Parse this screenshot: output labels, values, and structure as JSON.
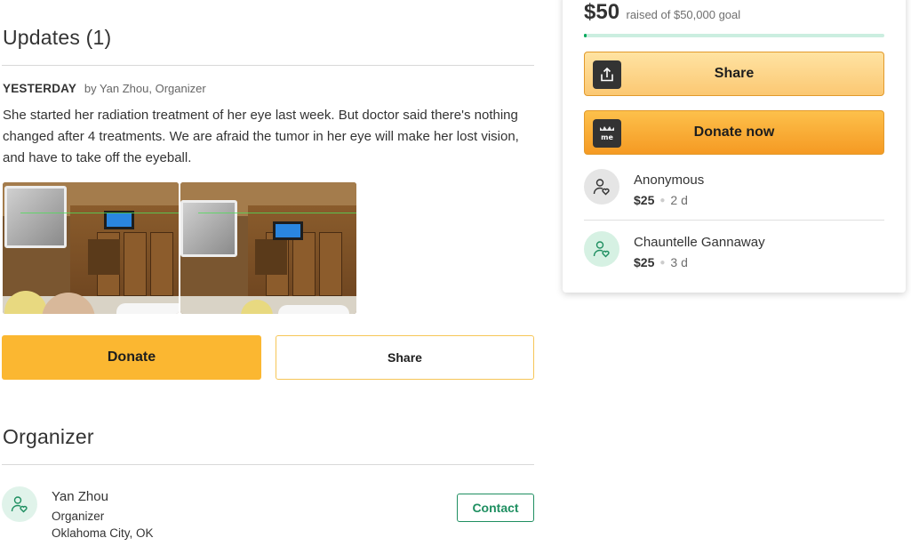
{
  "updates": {
    "title": "Updates (1)",
    "when": "YESTERDAY",
    "byline": "by Yan Zhou, Organizer",
    "text": "She started her radiation treatment of her eye last week. But doctor said there's nothing changed after 4 treatments. We are afraid the tumor in her eye will make her lost vision, and have to take off the eyeball."
  },
  "actions": {
    "donate_label": "Donate",
    "share_label": "Share"
  },
  "organizer": {
    "title": "Organizer",
    "name": "Yan Zhou",
    "role": "Organizer",
    "location": "Oklahoma City, OK",
    "contact_label": "Contact"
  },
  "sidebar": {
    "raised_amount": "$50",
    "raised_text": "raised of $50,000 goal",
    "progress_fraction": 0.001,
    "share_label": "Share",
    "donate_now_label": "Donate now",
    "donations": [
      {
        "name": "Anonymous",
        "amount": "$25",
        "time": "2 d"
      },
      {
        "name": "Chauntelle Gannaway",
        "amount": "$25",
        "time": "3 d"
      }
    ]
  },
  "colors": {
    "accent_yellow": "#fbb731",
    "progress_green": "#02a95c",
    "contact_green": "#1f8f61"
  },
  "icons": [
    "share-icon",
    "gofundme-icon",
    "donor-heart-icon",
    "organizer-heart-icon"
  ]
}
